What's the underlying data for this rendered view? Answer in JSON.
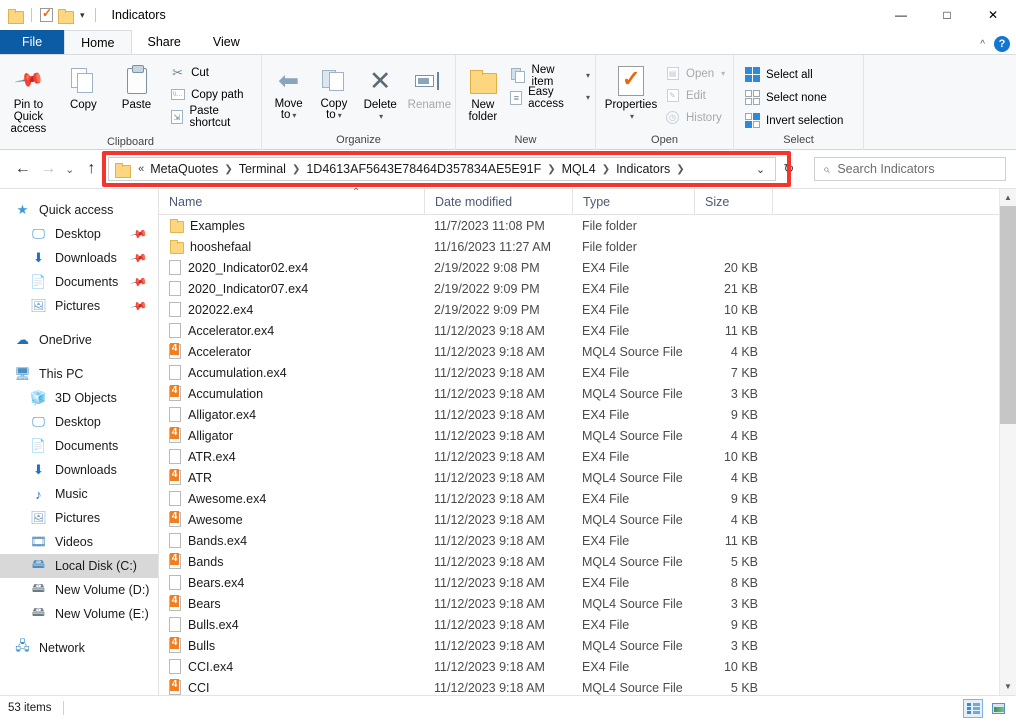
{
  "window": {
    "title": "Indicators",
    "quick_access": [
      "folder-icon",
      "properties-icon",
      "new-folder-icon",
      "dropdown-caret"
    ],
    "controls": {
      "minimize": "—",
      "maximize": "□",
      "close": "✕"
    },
    "ribbon_collapse": "^",
    "help": "?"
  },
  "tabs": [
    {
      "label": "File",
      "id": "file"
    },
    {
      "label": "Home",
      "id": "home"
    },
    {
      "label": "Share",
      "id": "share"
    },
    {
      "label": "View",
      "id": "view"
    }
  ],
  "ribbon": {
    "groups": [
      {
        "title": "Clipboard",
        "big": [
          {
            "label": "Pin to Quick access",
            "icon": "pin-icon"
          },
          {
            "label": "Copy",
            "icon": "copy-icon"
          },
          {
            "label": "Paste",
            "icon": "paste-icon"
          }
        ],
        "small": [
          {
            "label": "Cut",
            "icon": "scissors-icon"
          },
          {
            "label": "Copy path",
            "icon": "copy-path-icon"
          },
          {
            "label": "Paste shortcut",
            "icon": "paste-shortcut-icon"
          }
        ]
      },
      {
        "title": "Organize",
        "big": [
          {
            "label": "Move to",
            "icon": "move-to-icon",
            "dropdown": true
          },
          {
            "label": "Copy to",
            "icon": "copy-to-icon",
            "dropdown": true
          },
          {
            "label": "Delete",
            "icon": "delete-icon",
            "dropdown": true
          },
          {
            "label": "Rename",
            "icon": "rename-icon"
          }
        ],
        "small": []
      },
      {
        "title": "New",
        "big": [
          {
            "label": "New folder",
            "icon": "new-folder-icon"
          }
        ],
        "small": [
          {
            "label": "New item",
            "icon": "new-item-icon",
            "dropdown": true
          },
          {
            "label": "Easy access",
            "icon": "easy-access-icon",
            "dropdown": true
          }
        ]
      },
      {
        "title": "Open",
        "big": [
          {
            "label": "Properties",
            "icon": "properties-icon",
            "dropdown": true
          }
        ],
        "small": [
          {
            "label": "Open",
            "icon": "open-icon",
            "dropdown": true
          },
          {
            "label": "Edit",
            "icon": "edit-icon"
          },
          {
            "label": "History",
            "icon": "history-icon"
          }
        ]
      },
      {
        "title": "Select",
        "big": [],
        "small": [
          {
            "label": "Select all",
            "icon": "select-all-icon"
          },
          {
            "label": "Select none",
            "icon": "select-none-icon"
          },
          {
            "label": "Invert selection",
            "icon": "invert-selection-icon"
          }
        ]
      }
    ]
  },
  "address": {
    "back": "←",
    "forward": "→",
    "recent": "⌵",
    "up": "↑",
    "overflow": "«",
    "crumbs": [
      "MetaQuotes",
      "Terminal",
      "1D4613AF5643E78464D357834AE5E91F",
      "MQL4",
      "Indicators"
    ],
    "dropdown": "⌵",
    "refresh": "↻",
    "highlight_color": "#f3352e"
  },
  "search": {
    "placeholder": "Search Indicators",
    "icon": "search-icon"
  },
  "navpane": {
    "sections": [
      {
        "label": "Quick access",
        "icon": "star-icon",
        "level": 0,
        "children": [
          {
            "label": "Desktop",
            "icon": "desktop-icon",
            "pinned": true
          },
          {
            "label": "Downloads",
            "icon": "downloads-icon",
            "pinned": true
          },
          {
            "label": "Documents",
            "icon": "documents-icon",
            "pinned": true
          },
          {
            "label": "Pictures",
            "icon": "pictures-icon",
            "pinned": true
          }
        ]
      },
      {
        "label": "OneDrive",
        "icon": "cloud-icon",
        "level": 0,
        "children": []
      },
      {
        "label": "This PC",
        "icon": "this-pc-icon",
        "level": 0,
        "children": [
          {
            "label": "3D Objects",
            "icon": "3d-objects-icon"
          },
          {
            "label": "Desktop",
            "icon": "desktop-icon"
          },
          {
            "label": "Documents",
            "icon": "documents-icon"
          },
          {
            "label": "Downloads",
            "icon": "downloads-icon"
          },
          {
            "label": "Music",
            "icon": "music-icon"
          },
          {
            "label": "Pictures",
            "icon": "pictures-icon"
          },
          {
            "label": "Videos",
            "icon": "videos-icon"
          },
          {
            "label": "Local Disk (C:)",
            "icon": "local-disk-icon",
            "selected": true
          },
          {
            "label": "New Volume (D:)",
            "icon": "drive-icon"
          },
          {
            "label": "New Volume (E:)",
            "icon": "drive-icon"
          }
        ]
      },
      {
        "label": "Network",
        "icon": "network-icon",
        "level": 0,
        "children": []
      }
    ]
  },
  "filelist": {
    "columns": [
      "Name",
      "Date modified",
      "Type",
      "Size"
    ],
    "sort": {
      "column": "Name",
      "direction": "ascending"
    },
    "rows": [
      {
        "name": "Examples",
        "date": "11/7/2023 11:08 PM",
        "type": "File folder",
        "size": "",
        "icon": "folder"
      },
      {
        "name": "hooshefaal",
        "date": "11/16/2023 11:27 AM",
        "type": "File folder",
        "size": "",
        "icon": "folder"
      },
      {
        "name": "2020_Indicator02.ex4",
        "date": "2/19/2022 9:08 PM",
        "type": "EX4 File",
        "size": "20 KB",
        "icon": "ex4"
      },
      {
        "name": "2020_Indicator07.ex4",
        "date": "2/19/2022 9:09 PM",
        "type": "EX4 File",
        "size": "21 KB",
        "icon": "ex4"
      },
      {
        "name": "202022.ex4",
        "date": "2/19/2022 9:09 PM",
        "type": "EX4 File",
        "size": "10 KB",
        "icon": "ex4"
      },
      {
        "name": "Accelerator.ex4",
        "date": "11/12/2023 9:18 AM",
        "type": "EX4 File",
        "size": "11 KB",
        "icon": "ex4"
      },
      {
        "name": "Accelerator",
        "date": "11/12/2023 9:18 AM",
        "type": "MQL4 Source File",
        "size": "4 KB",
        "icon": "mql4"
      },
      {
        "name": "Accumulation.ex4",
        "date": "11/12/2023 9:18 AM",
        "type": "EX4 File",
        "size": "7 KB",
        "icon": "ex4"
      },
      {
        "name": "Accumulation",
        "date": "11/12/2023 9:18 AM",
        "type": "MQL4 Source File",
        "size": "3 KB",
        "icon": "mql4"
      },
      {
        "name": "Alligator.ex4",
        "date": "11/12/2023 9:18 AM",
        "type": "EX4 File",
        "size": "9 KB",
        "icon": "ex4"
      },
      {
        "name": "Alligator",
        "date": "11/12/2023 9:18 AM",
        "type": "MQL4 Source File",
        "size": "4 KB",
        "icon": "mql4"
      },
      {
        "name": "ATR.ex4",
        "date": "11/12/2023 9:18 AM",
        "type": "EX4 File",
        "size": "10 KB",
        "icon": "ex4"
      },
      {
        "name": "ATR",
        "date": "11/12/2023 9:18 AM",
        "type": "MQL4 Source File",
        "size": "4 KB",
        "icon": "mql4"
      },
      {
        "name": "Awesome.ex4",
        "date": "11/12/2023 9:18 AM",
        "type": "EX4 File",
        "size": "9 KB",
        "icon": "ex4"
      },
      {
        "name": "Awesome",
        "date": "11/12/2023 9:18 AM",
        "type": "MQL4 Source File",
        "size": "4 KB",
        "icon": "mql4"
      },
      {
        "name": "Bands.ex4",
        "date": "11/12/2023 9:18 AM",
        "type": "EX4 File",
        "size": "11 KB",
        "icon": "ex4"
      },
      {
        "name": "Bands",
        "date": "11/12/2023 9:18 AM",
        "type": "MQL4 Source File",
        "size": "5 KB",
        "icon": "mql4"
      },
      {
        "name": "Bears.ex4",
        "date": "11/12/2023 9:18 AM",
        "type": "EX4 File",
        "size": "8 KB",
        "icon": "ex4"
      },
      {
        "name": "Bears",
        "date": "11/12/2023 9:18 AM",
        "type": "MQL4 Source File",
        "size": "3 KB",
        "icon": "mql4"
      },
      {
        "name": "Bulls.ex4",
        "date": "11/12/2023 9:18 AM",
        "type": "EX4 File",
        "size": "9 KB",
        "icon": "ex4"
      },
      {
        "name": "Bulls",
        "date": "11/12/2023 9:18 AM",
        "type": "MQL4 Source File",
        "size": "3 KB",
        "icon": "mql4"
      },
      {
        "name": "CCI.ex4",
        "date": "11/12/2023 9:18 AM",
        "type": "EX4 File",
        "size": "10 KB",
        "icon": "ex4"
      },
      {
        "name": "CCI",
        "date": "11/12/2023 9:18 AM",
        "type": "MQL4 Source File",
        "size": "5 KB",
        "icon": "mql4"
      }
    ]
  },
  "status": {
    "item_count": "53 items",
    "views": [
      {
        "name": "details-view",
        "active": true
      },
      {
        "name": "thumbnails-view",
        "active": false
      }
    ]
  }
}
